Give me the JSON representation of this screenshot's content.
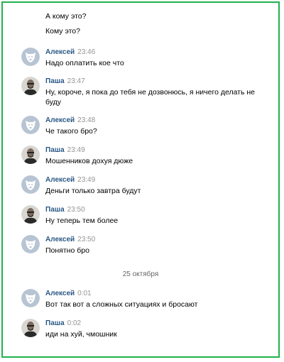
{
  "earlier_lines": [
    "А кому это?",
    "Кому это?"
  ],
  "date_divider": "25 октября",
  "messages": [
    {
      "author": "Алексей",
      "time": "23:46",
      "text": "Надо оплатить кое что",
      "avatar": "dog-avatar"
    },
    {
      "author": "Паша",
      "time": "23:47",
      "text": "Ну, короче, я пока до тебя не дозвонюсь, я ничего делать не буду",
      "avatar": "photo-avatar"
    },
    {
      "author": "Алексей",
      "time": "23:48",
      "text": "Че такого бро?",
      "avatar": "dog-avatar"
    },
    {
      "author": "Паша",
      "time": "23:49",
      "text": "Мошенников дохуя дюже",
      "avatar": "photo-avatar"
    },
    {
      "author": "Алексей",
      "time": "23:49",
      "text": "Деньги только завтра будут",
      "avatar": "dog-avatar"
    },
    {
      "author": "Паша",
      "time": "23:50",
      "text": "Ну теперь тем более",
      "avatar": "photo-avatar"
    },
    {
      "author": "Алексей",
      "time": "23:50",
      "text": "Понятно бро",
      "avatar": "dog-avatar"
    },
    {
      "author": "Алексей",
      "time": "0:01",
      "text": "Вот так вот а сложных ситуациях и бросают",
      "avatar": "dog-avatar"
    },
    {
      "author": "Паша",
      "time": "0:02",
      "text": "иди на хуй, чмошник",
      "avatar": "photo-avatar"
    }
  ],
  "colors": {
    "frame": "#22b14c",
    "author": "#2a5885",
    "time": "#939393"
  }
}
